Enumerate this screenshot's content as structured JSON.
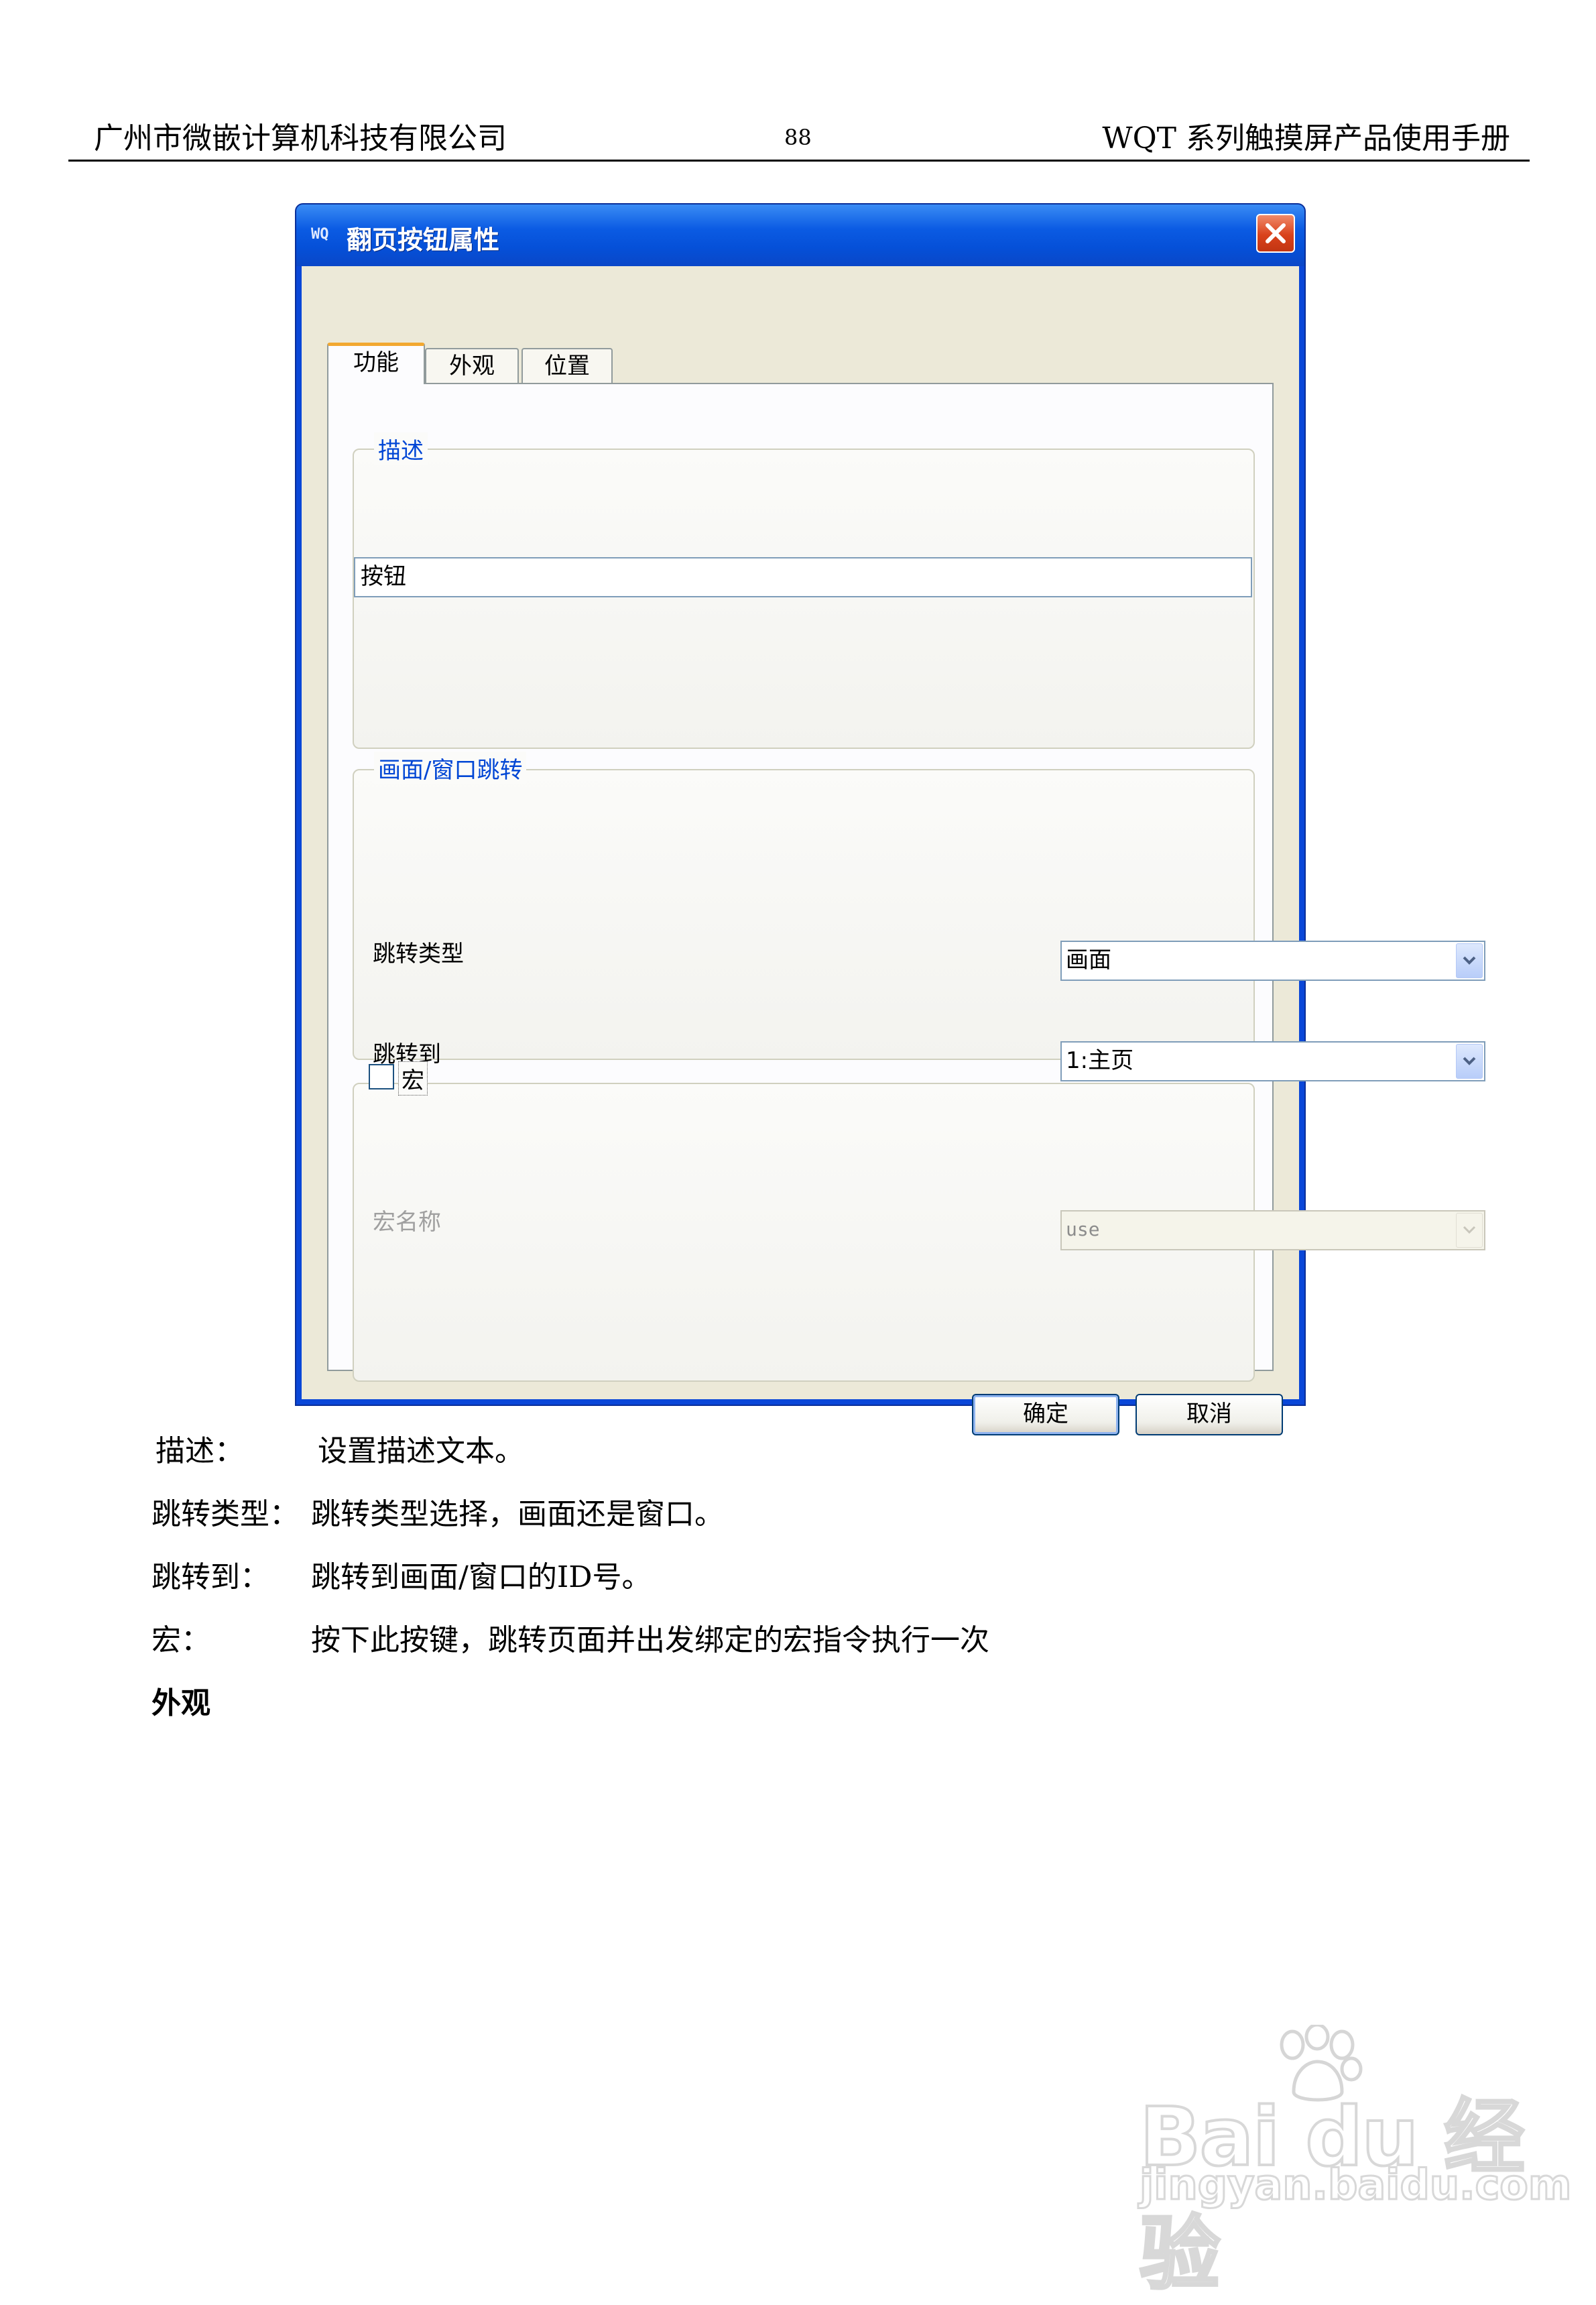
{
  "header": {
    "company": "广州市微嵌计算机科技有限公司",
    "page_number": "88",
    "manual_title": "WQT 系列触摸屏产品使用手册"
  },
  "dialog": {
    "title": "翻页按钮属性",
    "title_icon": "WQ",
    "close_icon": "close-icon",
    "tabs": [
      "功能",
      "外观",
      "位置"
    ],
    "active_tab": "功能",
    "description": {
      "group_title": "描述",
      "value": "按钮"
    },
    "jump": {
      "group_title": "画面/窗口跳转",
      "type_label": "跳转类型",
      "type_value": "画面",
      "target_label": "跳转到",
      "target_value": "1:主页"
    },
    "macro": {
      "checkbox_label": "宏",
      "checked": false,
      "name_label": "宏名称",
      "name_value": "use"
    },
    "buttons": {
      "ok": "确定",
      "cancel": "取消"
    }
  },
  "body": {
    "items": [
      {
        "term": "描述：",
        "definition": "设置描述文本。"
      },
      {
        "term": "跳转类型：",
        "definition": "跳转类型选择，画面还是窗口。"
      },
      {
        "term": "跳转到：",
        "definition": "跳转到画面/窗口的ID号。"
      },
      {
        "term": "宏：",
        "definition": "按下此按键，跳转页面并出发绑定的宏指令执行一次"
      }
    ],
    "next_section": "外观"
  },
  "watermark": {
    "brand": "Bai du 经验",
    "url": "jingyan.baidu.com"
  }
}
